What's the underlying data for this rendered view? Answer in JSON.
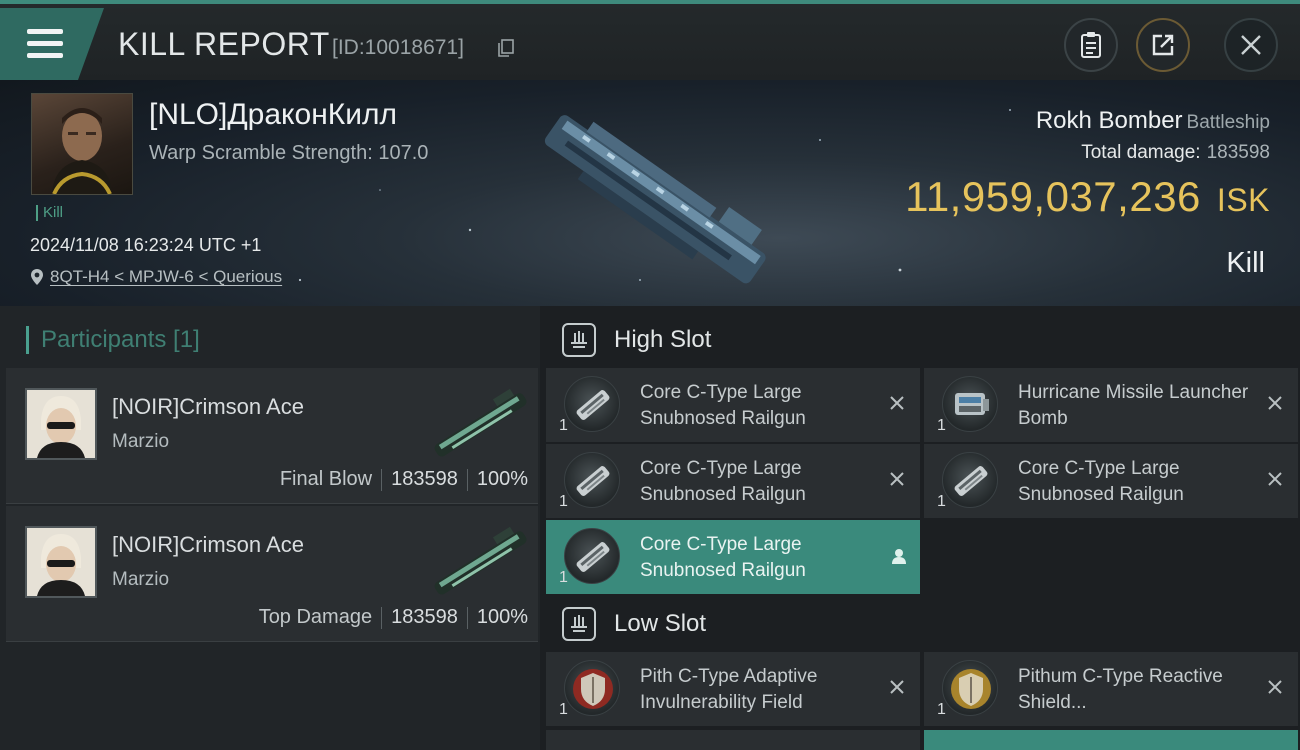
{
  "header": {
    "title": "KILL REPORT",
    "report_id": "[ID:10018671]",
    "icons": [
      "menu-icon",
      "copy-icon",
      "clipboard-icon",
      "share-icon",
      "close-icon"
    ]
  },
  "victim": {
    "name": "[NLO]ДраконКилл",
    "warp_scramble": "Warp Scramble Strength: 107.0",
    "kill_tag": "Kill",
    "datetime": "2024/11/08 16:23:24 UTC +1",
    "location": "8QT-H4 < MPJW-6 < Querious",
    "ship_name": "Rokh Bomber",
    "ship_class": "Battleship",
    "total_damage_label": "Total damage:",
    "total_damage_value": "183598",
    "isk_value": "11,959,037,236",
    "isk_unit": "ISK",
    "result": "Kill"
  },
  "participants": {
    "header": "Participants [1]",
    "rows": [
      {
        "name": "[NOIR]Crimson Ace",
        "corp": "Marzio",
        "label": "Final Blow",
        "damage": "183598",
        "percent": "100%"
      },
      {
        "name": "[NOIR]Crimson Ace",
        "corp": "Marzio",
        "label": "Top Damage",
        "damage": "183598",
        "percent": "100%"
      }
    ]
  },
  "high_slot": {
    "label": "High Slot",
    "modules": [
      {
        "name": "Core C-Type Large Snubnosed Railgun",
        "qty": "1",
        "selected": false
      },
      {
        "name": "Hurricane Missile Launcher Bomb",
        "qty": "1",
        "selected": false
      },
      {
        "name": "Core C-Type Large Snubnosed Railgun",
        "qty": "1",
        "selected": false
      },
      {
        "name": "Core C-Type Large Snubnosed Railgun",
        "qty": "1",
        "selected": false
      },
      {
        "name": "Core C-Type Large Snubnosed Railgun",
        "qty": "1",
        "selected": true
      }
    ]
  },
  "low_slot": {
    "label": "Low Slot",
    "modules": [
      {
        "name": "Pith C-Type Adaptive Invulnerability Field",
        "qty": "1"
      },
      {
        "name": "Pithum C-Type Reactive Shield...",
        "qty": "1"
      }
    ]
  },
  "colors": {
    "accent": "#3a8a7c",
    "isk": "#e6c35c",
    "kill_tag": "#4e9f86"
  }
}
